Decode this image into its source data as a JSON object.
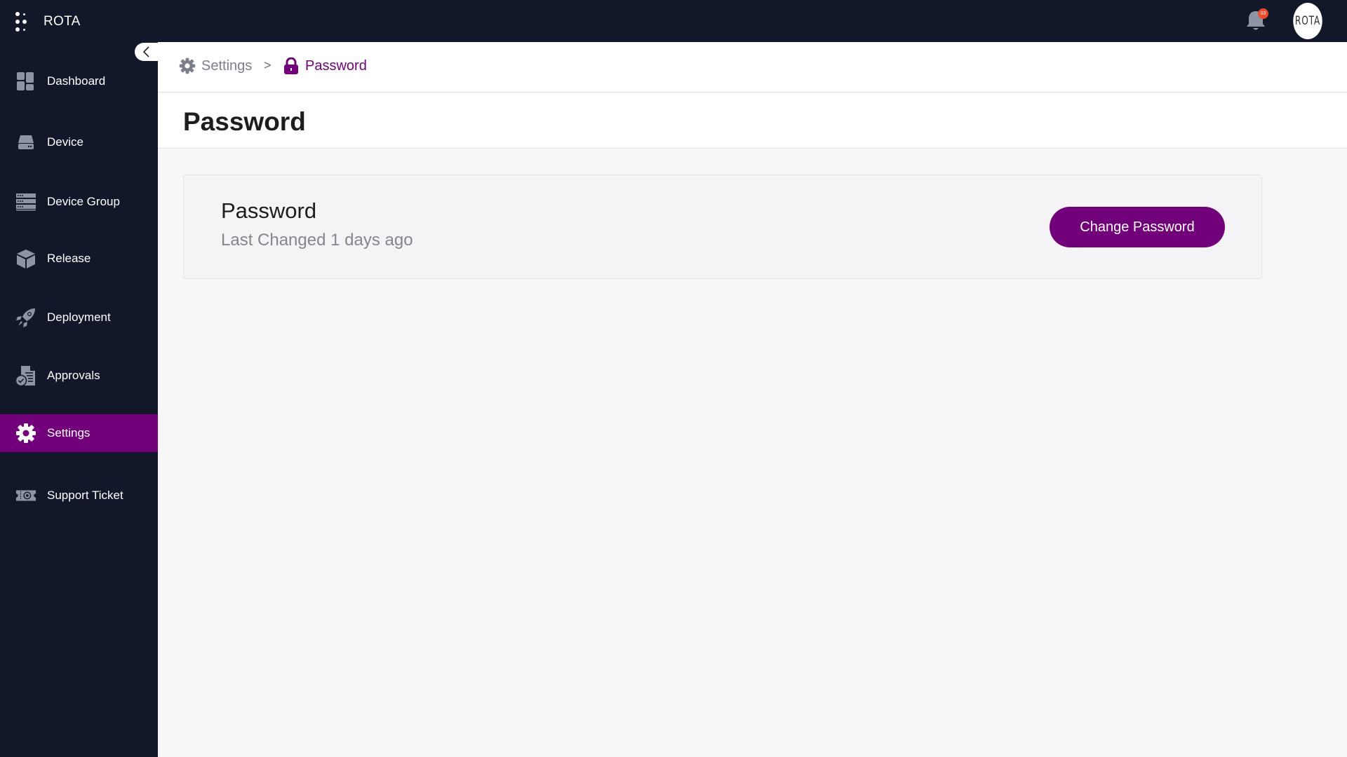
{
  "app": {
    "name": "ROTA",
    "avatar_text": "ROTA"
  },
  "notifications": {
    "count": "03"
  },
  "colors": {
    "brand": "#72007a",
    "sidebar_bg": "#121829",
    "badge": "#f04a2a"
  },
  "sidebar": {
    "items": [
      {
        "label": "Dashboard",
        "icon": "dashboard-icon",
        "active": false
      },
      {
        "label": "Device",
        "icon": "device-icon",
        "active": false
      },
      {
        "label": "Device Group",
        "icon": "device-group-icon",
        "active": false
      },
      {
        "label": "Release",
        "icon": "release-box-icon",
        "active": false
      },
      {
        "label": "Deployment",
        "icon": "rocket-icon",
        "active": false
      },
      {
        "label": "Approvals",
        "icon": "approvals-icon",
        "active": false
      },
      {
        "label": "Settings",
        "icon": "gear-icon",
        "active": true
      },
      {
        "label": "Support Ticket",
        "icon": "ticket-icon",
        "active": false
      }
    ]
  },
  "breadcrumb": {
    "items": [
      {
        "label": "Settings",
        "icon": "gear-icon"
      },
      {
        "label": "Password",
        "icon": "lock-icon"
      }
    ],
    "separator": ">"
  },
  "page": {
    "title": "Password"
  },
  "password_card": {
    "title": "Password",
    "last_changed": "Last Changed 1 days ago",
    "button_label": "Change Password"
  }
}
